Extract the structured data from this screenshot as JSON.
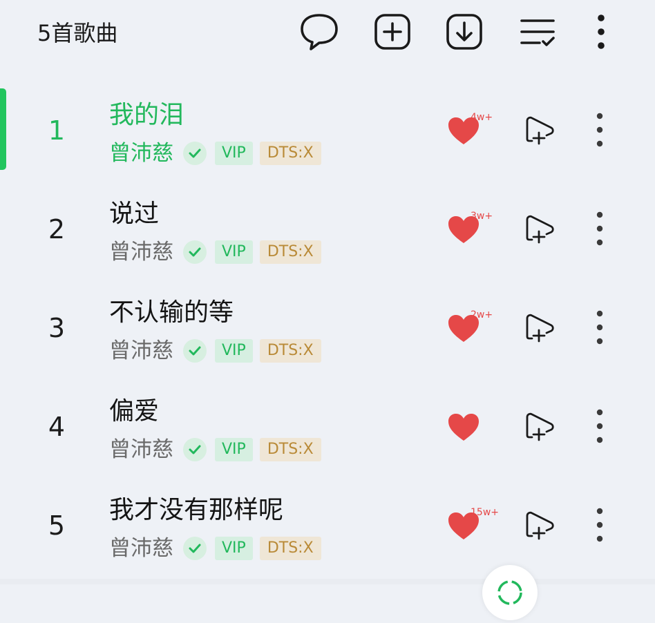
{
  "header": {
    "title": "5首歌曲",
    "icons": [
      "comment-icon",
      "add-icon",
      "download-icon",
      "multi-select-icon",
      "more-icon"
    ]
  },
  "colors": {
    "accent": "#22b85c",
    "heart": "#e54848",
    "vip_bg": "#d6efe1",
    "dts_text": "#b98a37"
  },
  "songs": [
    {
      "index": "1",
      "title": "我的泪",
      "artist": "曾沛慈",
      "vip": "VIP",
      "quality": "DTS:X",
      "likes": "4w+",
      "active": true
    },
    {
      "index": "2",
      "title": "说过",
      "artist": "曾沛慈",
      "vip": "VIP",
      "quality": "DTS:X",
      "likes": "3w+",
      "active": false
    },
    {
      "index": "3",
      "title": "不认输的等",
      "artist": "曾沛慈",
      "vip": "VIP",
      "quality": "DTS:X",
      "likes": "2w+",
      "active": false
    },
    {
      "index": "4",
      "title": "偏爱",
      "artist": "曾沛慈",
      "vip": "VIP",
      "quality": "DTS:X",
      "likes": "",
      "active": false
    },
    {
      "index": "5",
      "title": "我才没有那样呢",
      "artist": "曾沛慈",
      "vip": "VIP",
      "quality": "DTS:X",
      "likes": "15w+",
      "active": false
    }
  ]
}
